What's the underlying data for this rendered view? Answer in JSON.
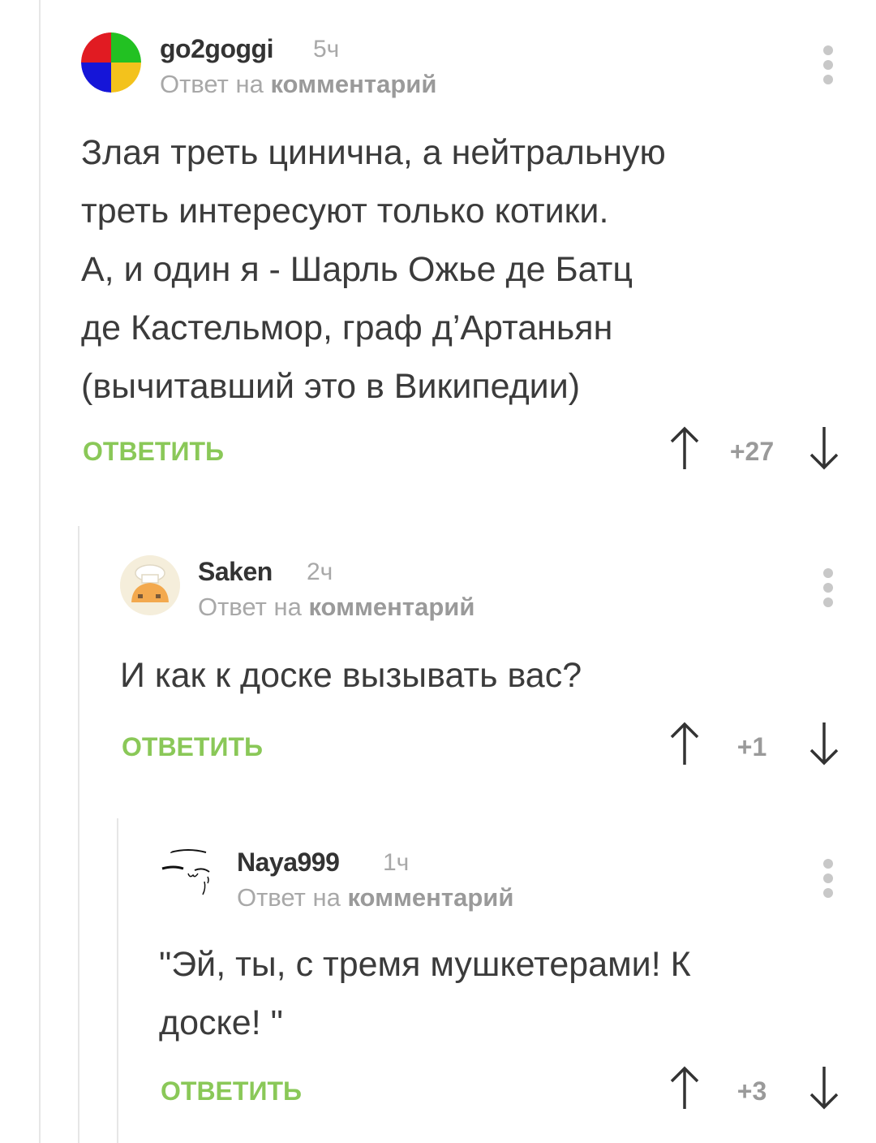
{
  "comments": [
    {
      "username": "go2goggi",
      "time": "5ч",
      "reply_prefix": "Ответ на ",
      "reply_link": "комментарий",
      "text": "Злая треть цинична, а нейтральную\nтреть интересуют только котики.\nА, и один я - Шарль Ожье де Батц\nде Кастельмор, граф д’Артаньян\n(вычитавший это в Википедии)",
      "reply_label": "ОТВЕТИТЬ",
      "rating": "+27"
    },
    {
      "username": "Saken",
      "time": "2ч",
      "reply_prefix": "Ответ на ",
      "reply_link": "комментарий",
      "text": "И как к доске вызывать вас?",
      "reply_label": "ОТВЕТИТЬ",
      "rating": "+1"
    },
    {
      "username": "Naya999",
      "time": "1ч",
      "reply_prefix": "Ответ на ",
      "reply_link": "комментарий",
      "text": "\"Эй, ты, с тремя мушкетерами! К\nдоске! \"",
      "reply_label": "ОТВЕТИТЬ",
      "rating": "+3"
    }
  ],
  "icons": {
    "avatar_1": "four-color-circle-avatar",
    "avatar_2": "chef-hat-cat-avatar",
    "avatar_3": "sketch-face-avatar",
    "menu": "vertical-dots-icon",
    "up": "arrow-up-icon",
    "down": "arrow-down-icon"
  },
  "colors": {
    "reply_button": "#8ac858",
    "meta_text": "#a8a8a8",
    "body_text": "#3b3b3b"
  }
}
